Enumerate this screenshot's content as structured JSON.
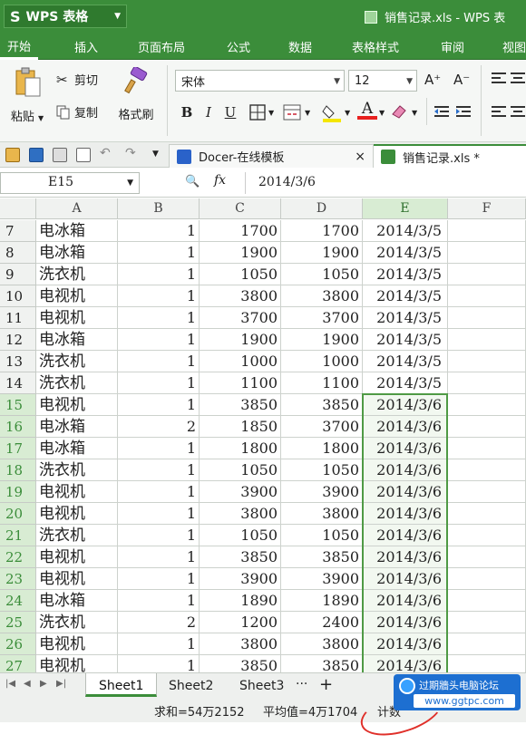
{
  "app": {
    "name": "WPS 表格",
    "logo_glyph": "S",
    "document_title": "销售记录.xls - WPS 表"
  },
  "menu": [
    "开始",
    "插入",
    "页面布局",
    "公式",
    "数据",
    "表格样式",
    "审阅",
    "视图"
  ],
  "ribbon": {
    "paste_label": "粘贴",
    "cut_label": "剪切",
    "copy_label": "复制",
    "format_painter_label": "格式刷",
    "font_name": "宋体",
    "font_size": "12",
    "bold_glyph": "B",
    "italic_glyph": "I",
    "underline_glyph": "U",
    "grow_font_glyph": "A⁺",
    "shrink_font_glyph": "A⁻",
    "font_color_glyph": "A",
    "colors": {
      "font_color": "#e8201e",
      "fill_color": "#f4e600",
      "accent": "#3b8d3a"
    }
  },
  "doc_tabs": [
    {
      "label": "Docer-在线模板",
      "close_glyph": "×"
    },
    {
      "label": "销售记录.xls *"
    }
  ],
  "formula_bar": {
    "cell_ref": "E15",
    "fx_label": "fx",
    "value": "2014/3/6"
  },
  "grid": {
    "columns": [
      "A",
      "B",
      "C",
      "D",
      "E",
      "F"
    ],
    "rows": [
      {
        "n": "7",
        "a": "电冰箱",
        "b": "1",
        "c": "1700",
        "d": "1700",
        "e": "2014/3/5"
      },
      {
        "n": "8",
        "a": "电冰箱",
        "b": "1",
        "c": "1900",
        "d": "1900",
        "e": "2014/3/5"
      },
      {
        "n": "9",
        "a": "洗衣机",
        "b": "1",
        "c": "1050",
        "d": "1050",
        "e": "2014/3/5"
      },
      {
        "n": "10",
        "a": "电视机",
        "b": "1",
        "c": "3800",
        "d": "3800",
        "e": "2014/3/5"
      },
      {
        "n": "11",
        "a": "电视机",
        "b": "1",
        "c": "3700",
        "d": "3700",
        "e": "2014/3/5"
      },
      {
        "n": "12",
        "a": "电冰箱",
        "b": "1",
        "c": "1900",
        "d": "1900",
        "e": "2014/3/5"
      },
      {
        "n": "13",
        "a": "洗衣机",
        "b": "1",
        "c": "1000",
        "d": "1000",
        "e": "2014/3/5"
      },
      {
        "n": "14",
        "a": "洗衣机",
        "b": "1",
        "c": "1100",
        "d": "1100",
        "e": "2014/3/5"
      },
      {
        "n": "15",
        "a": "电视机",
        "b": "1",
        "c": "3850",
        "d": "3850",
        "e": "2014/3/6"
      },
      {
        "n": "16",
        "a": "电冰箱",
        "b": "2",
        "c": "1850",
        "d": "3700",
        "e": "2014/3/6"
      },
      {
        "n": "17",
        "a": "电冰箱",
        "b": "1",
        "c": "1800",
        "d": "1800",
        "e": "2014/3/6"
      },
      {
        "n": "18",
        "a": "洗衣机",
        "b": "1",
        "c": "1050",
        "d": "1050",
        "e": "2014/3/6"
      },
      {
        "n": "19",
        "a": "电视机",
        "b": "1",
        "c": "3900",
        "d": "3900",
        "e": "2014/3/6"
      },
      {
        "n": "20",
        "a": "电视机",
        "b": "1",
        "c": "3800",
        "d": "3800",
        "e": "2014/3/6"
      },
      {
        "n": "21",
        "a": "洗衣机",
        "b": "1",
        "c": "1050",
        "d": "1050",
        "e": "2014/3/6"
      },
      {
        "n": "22",
        "a": "电视机",
        "b": "1",
        "c": "3850",
        "d": "3850",
        "e": "2014/3/6"
      },
      {
        "n": "23",
        "a": "电视机",
        "b": "1",
        "c": "3900",
        "d": "3900",
        "e": "2014/3/6"
      },
      {
        "n": "24",
        "a": "电冰箱",
        "b": "1",
        "c": "1890",
        "d": "1890",
        "e": "2014/3/6"
      },
      {
        "n": "25",
        "a": "洗衣机",
        "b": "2",
        "c": "1200",
        "d": "2400",
        "e": "2014/3/6"
      },
      {
        "n": "26",
        "a": "电视机",
        "b": "1",
        "c": "3800",
        "d": "3800",
        "e": "2014/3/6"
      },
      {
        "n": "27",
        "a": "电视机",
        "b": "1",
        "c": "3850",
        "d": "3850",
        "e": "2014/3/6"
      }
    ],
    "selected_rows": [
      "15",
      "16",
      "17",
      "18",
      "19",
      "20",
      "21",
      "22",
      "23",
      "24",
      "25",
      "26",
      "27"
    ],
    "selected_column": "E"
  },
  "sheets": [
    "Sheet1",
    "Sheet2",
    "Sheet3"
  ],
  "sheet_more_glyph": "···",
  "sheet_add_glyph": "+",
  "status": {
    "sum": "求和=54万2152",
    "average": "平均值=4万1704",
    "count": "计数"
  },
  "watermark": {
    "title": "过期牆头电脑论坛",
    "url": "www.ggtpc.com"
  }
}
